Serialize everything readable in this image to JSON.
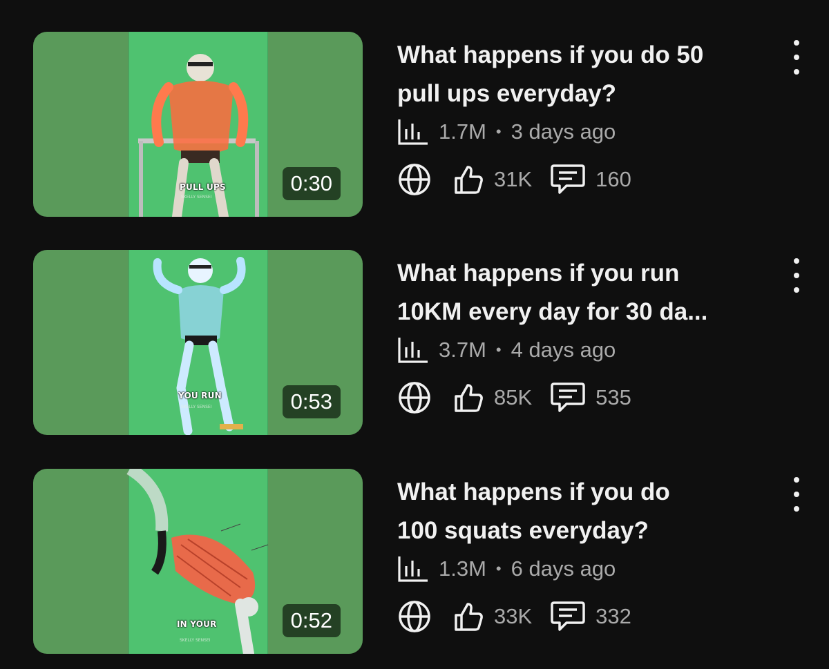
{
  "videos": [
    {
      "title_line1": "What happens if you do 50",
      "title_line2": "pull ups everyday?",
      "views": "1.7M",
      "separator": "•",
      "age": "3 days ago",
      "likes": "31K",
      "comments": "160",
      "duration": "0:30",
      "thumb_caption": "PULL UPS",
      "thumb_subcaption": "SKELLY SENSEI",
      "thumb_accent": "#ff6a3d"
    },
    {
      "title_line1": "What happens if you run",
      "title_line2": "10KM every day for 30 da...",
      "views": "3.7M",
      "separator": "•",
      "age": "4 days ago",
      "likes": "85K",
      "comments": "535",
      "duration": "0:53",
      "thumb_caption": "YOU RUN",
      "thumb_subcaption": "SKELLY SENSEI",
      "thumb_accent": "#9fd8ff"
    },
    {
      "title_line1": "What happens if you do",
      "title_line2": "100 squats everyday?",
      "views": "1.3M",
      "separator": "•",
      "age": "6 days ago",
      "likes": "33K",
      "comments": "332",
      "duration": "0:52",
      "thumb_caption": "IN YOUR",
      "thumb_subcaption": "SKELLY SENSEI",
      "thumb_accent": "#e86a4a"
    }
  ],
  "icons": {
    "views": "bar-chart-icon",
    "visibility": "globe-icon",
    "likes": "thumbs-up-icon",
    "comments": "comment-icon",
    "more": "more-vert-icon"
  },
  "colors": {
    "background": "#0f0f0f",
    "text_primary": "#f1f1f1",
    "text_secondary": "#aaaaaa",
    "thumb_green": "#4fc270"
  }
}
